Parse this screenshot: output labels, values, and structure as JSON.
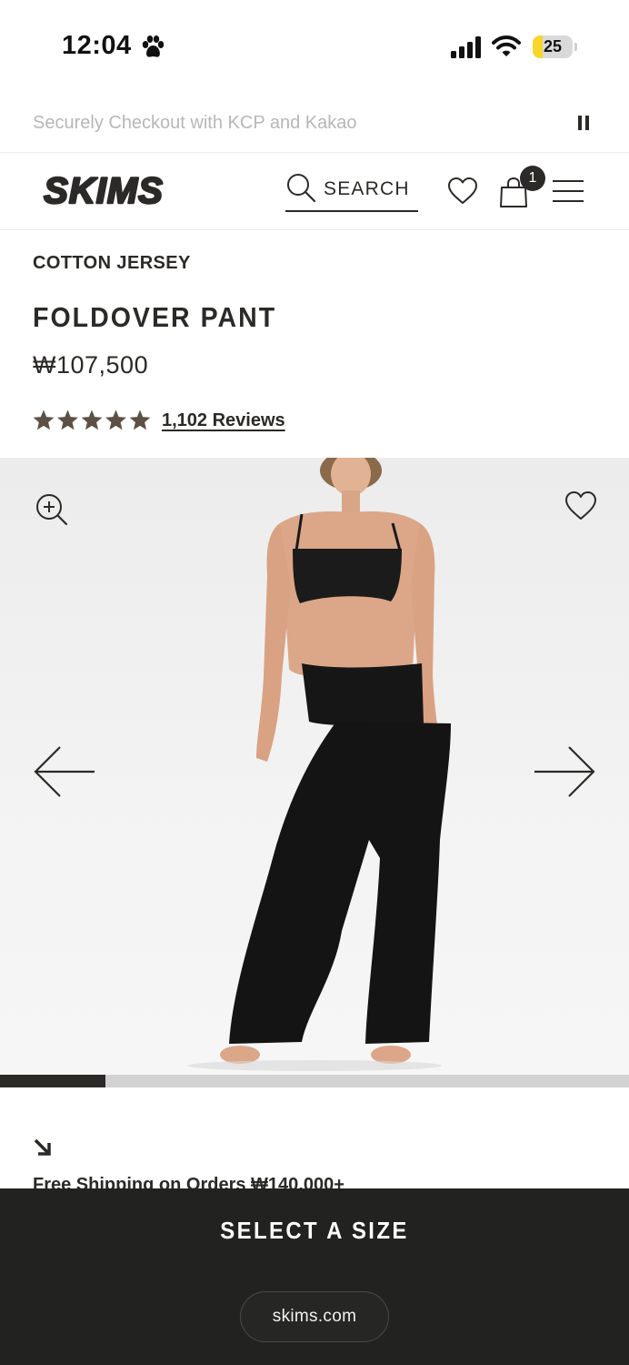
{
  "status_bar": {
    "time": "12:04",
    "battery_level": "25",
    "battery_fraction": 0.25,
    "battery_color": "#f7d52b"
  },
  "announcement": {
    "text": "Securely Checkout with KCP and Kakao",
    "pause_icon": "pause-icon"
  },
  "header": {
    "logo_text": "SKIMS",
    "search_label": "SEARCH",
    "cart_count": "1",
    "icons": [
      "search-icon",
      "heart-icon",
      "bag-icon",
      "menu-icon"
    ]
  },
  "product": {
    "collection": "COTTON JERSEY",
    "title": "FOLDOVER PANT",
    "price": "₩107,500",
    "rating": 5,
    "rating_max": 5,
    "star_color": "#5c5146",
    "reviews_label": "1,102 Reviews"
  },
  "gallery": {
    "icons": [
      "zoom-in-icon",
      "heart-icon",
      "arrow-left-icon",
      "arrow-right-icon"
    ],
    "progress_fraction": 0.167
  },
  "shipping": {
    "icon": "arrow-down-right-icon",
    "text": "Free Shipping on Orders ₩140,000+"
  },
  "bottom": {
    "cta_label": "SELECT A SIZE",
    "url": "skims.com",
    "background": "#222220"
  }
}
